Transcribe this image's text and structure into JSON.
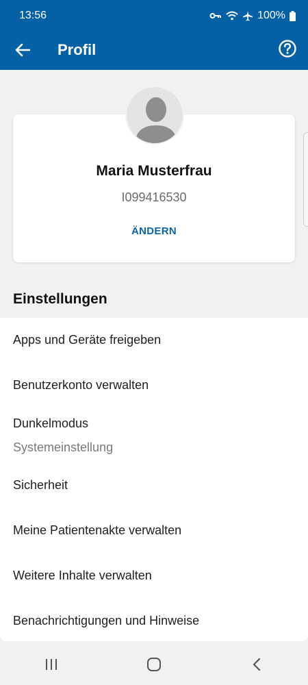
{
  "status_bar": {
    "time": "13:56",
    "battery_percent": "100%",
    "icons": [
      "vpn-key-icon",
      "wifi-icon",
      "airplane-icon",
      "battery-icon"
    ]
  },
  "app_bar": {
    "title": "Profil",
    "icons": [
      "back-arrow-icon",
      "help-icon"
    ],
    "color": "#0461a6"
  },
  "profile": {
    "name": "Maria Musterfrau",
    "id": "I099416530",
    "change_label": "ÄNDERN"
  },
  "settings": {
    "title": "Einstellungen",
    "items": [
      {
        "label": "Apps und Geräte freigeben"
      },
      {
        "label": "Benutzerkonto verwalten"
      },
      {
        "label": "Dunkelmodus",
        "sub": "Systemeinstellung"
      },
      {
        "label": "Sicherheit"
      },
      {
        "label": "Meine Patientenakte verwalten"
      },
      {
        "label": "Weitere Inhalte verwalten"
      },
      {
        "label": "Benachrichtigungen und Hinweise"
      }
    ]
  },
  "nav_bar": {
    "icons": [
      "recent-apps-icon",
      "home-icon",
      "back-icon"
    ]
  }
}
